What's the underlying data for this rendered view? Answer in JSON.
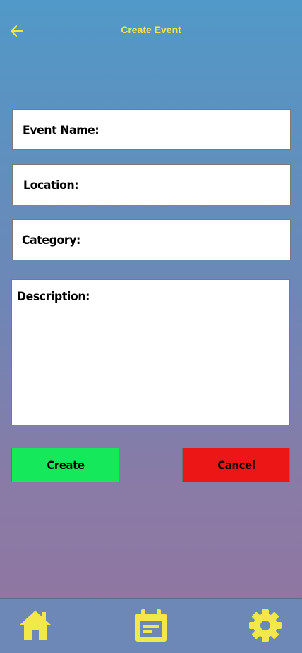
{
  "header": {
    "title": "Create Event",
    "back_icon": "arrow-left-icon"
  },
  "form": {
    "event_name_label": "Event Name:",
    "location_label": "Location:",
    "category_label": "Category:",
    "description_label": "Description:"
  },
  "actions": {
    "create_label": "Create",
    "cancel_label": "Cancel"
  },
  "bottom_nav": {
    "items": [
      {
        "icon": "home-icon"
      },
      {
        "icon": "calendar-icon"
      },
      {
        "icon": "gear-icon"
      }
    ]
  },
  "colors": {
    "accent_yellow": "#f2e84a",
    "create_green": "#15e85a",
    "cancel_red": "#ec1616",
    "nav_bg": "#6d88b6"
  }
}
